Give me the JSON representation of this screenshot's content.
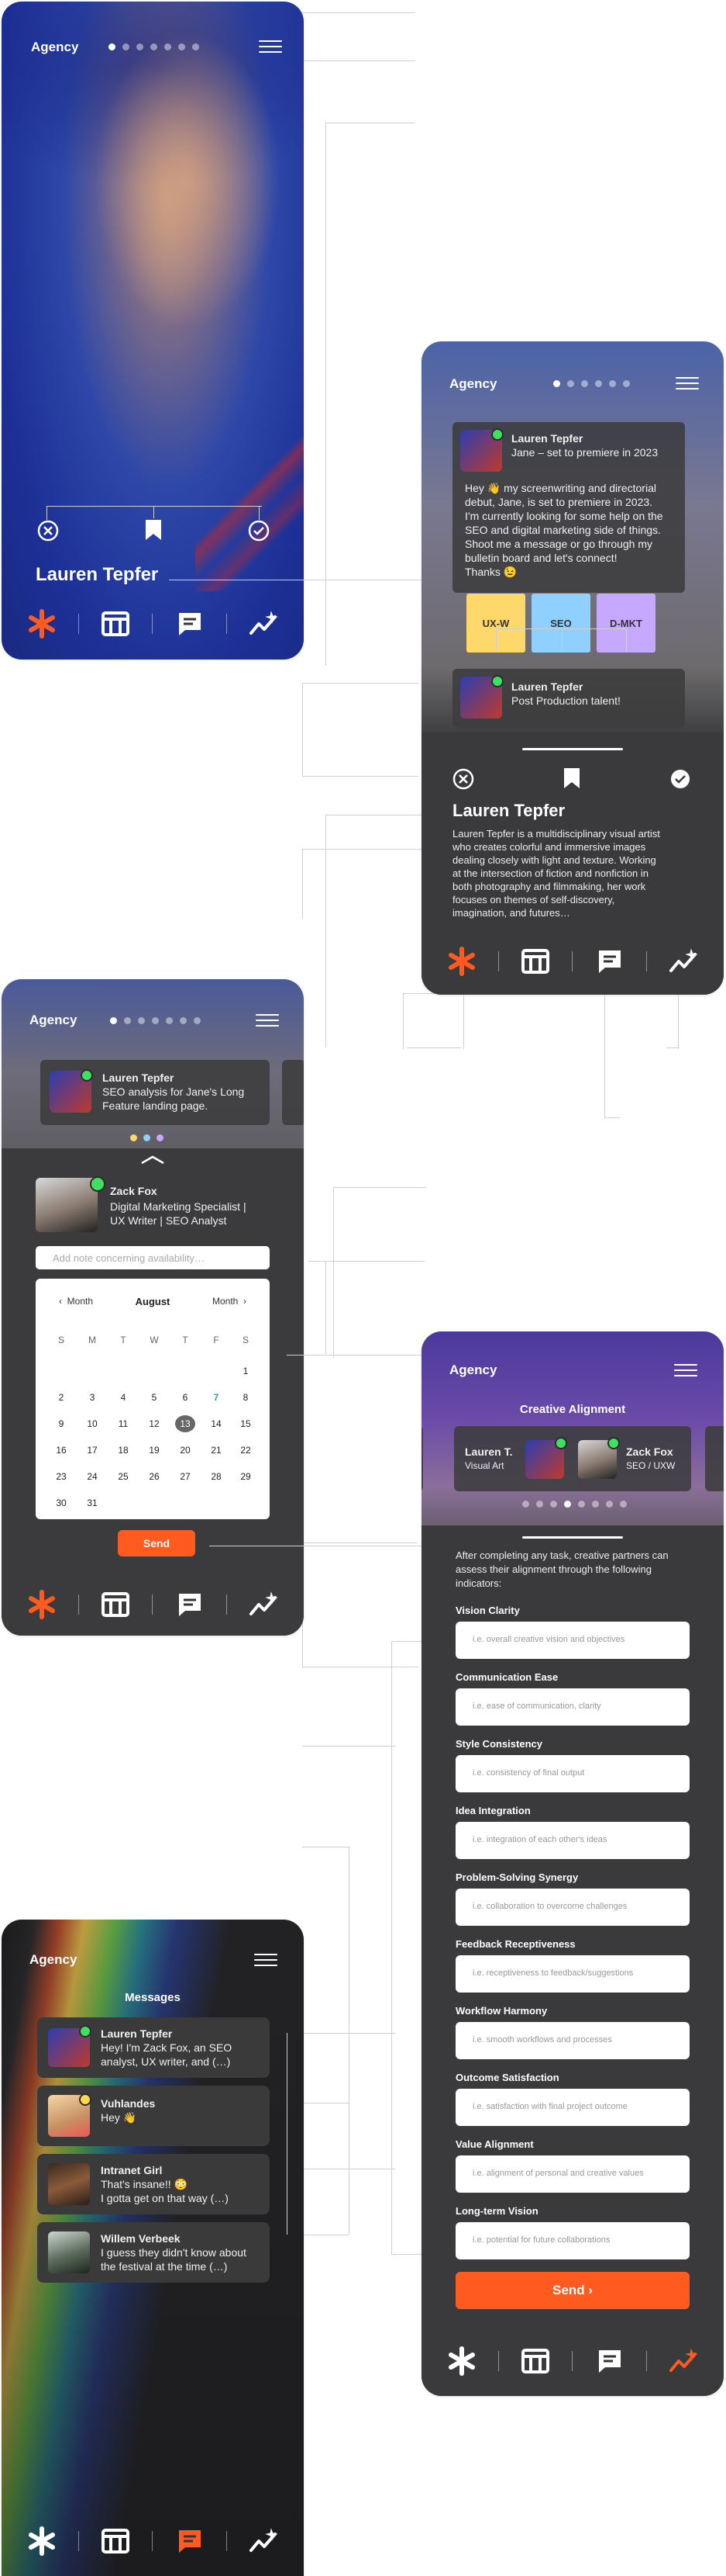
{
  "brand": "Agency",
  "screen1": {
    "name": "Lauren Tepfer"
  },
  "screen2": {
    "post": {
      "author": "Lauren Tepfer",
      "headline": "Jane – set to premiere in 2023",
      "body_lines": [
        "Hey 👋 my screenwriting and directorial",
        "debut, Jane, is set to premiere in 2023.",
        "I'm currently looking for some help on the",
        "SEO and digital marketing side of things.",
        "Shoot me a message or go through my",
        "bulletin board and let's connect!",
        "Thanks 😉"
      ]
    },
    "notes": [
      "UX-W",
      "SEO",
      "D-MKT"
    ],
    "post2": {
      "author": "Lauren Tepfer",
      "headline": "Post Production talent!"
    },
    "profile_name": "Lauren Tepfer",
    "bio_lines": [
      "Lauren Tepfer is a multidisciplinary visual artist",
      "who creates colorful and immersive images",
      "dealing closely with light and texture. Working",
      "at the intersection of fiction and nonfiction in",
      "both photography and filmmaking, her work",
      "focuses on themes of self-discovery,",
      "imagination, and futures…"
    ]
  },
  "screen3": {
    "post": {
      "author": "Lauren Tepfer",
      "line1": "SEO analysis for Jane's Long",
      "line2": "Feature landing page."
    },
    "person": {
      "name": "Zack Fox",
      "line1": "Digital Marketing Specialist |",
      "line2": "UX Writer | SEO Analyst"
    },
    "note_placeholder": "Add note concerning availability…",
    "calendar": {
      "prev": "Month",
      "month": "August",
      "next": "Month",
      "weekdays": [
        "S",
        "M",
        "T",
        "W",
        "T",
        "F",
        "S"
      ],
      "days": [
        "",
        "",
        "",
        "",
        "",
        "",
        "1",
        "2",
        "3",
        "4",
        "5",
        "6",
        "7",
        "8",
        "9",
        "10",
        "11",
        "12",
        "13",
        "14",
        "15",
        "16",
        "17",
        "18",
        "19",
        "20",
        "21",
        "22",
        "23",
        "24",
        "25",
        "26",
        "27",
        "28",
        "29",
        "30",
        "31"
      ],
      "selected": "13",
      "highlight": "7"
    },
    "send": "Send"
  },
  "screen4": {
    "title": "Creative Alignment",
    "left": {
      "name": "Lauren T.",
      "role": "Visual Art"
    },
    "right": {
      "name": "Zack Fox",
      "role": "SEO / UXW"
    },
    "intro_lines": [
      "After completing any task, creative partners can",
      "assess their alignment through the following",
      "indicators:"
    ],
    "indicators": [
      {
        "label": "Vision Clarity",
        "placeholder": "i.e. overall creative vision and objectives"
      },
      {
        "label": "Communication Ease",
        "placeholder": "i.e. ease of communication, clarity"
      },
      {
        "label": "Style Consistency",
        "placeholder": "i.e. consistency of final output"
      },
      {
        "label": "Idea Integration",
        "placeholder": "i.e. integration of each other's ideas"
      },
      {
        "label": "Problem-Solving Synergy",
        "placeholder": "i.e. collaboration to overcome challenges"
      },
      {
        "label": "Feedback Receptiveness",
        "placeholder": "i.e. receptiveness to feedback/suggestions"
      },
      {
        "label": "Workflow Harmony",
        "placeholder": "i.e. smooth workflows and processes"
      },
      {
        "label": "Outcome Satisfaction",
        "placeholder": "i.e. satisfaction with final project outcome"
      },
      {
        "label": "Value Alignment",
        "placeholder": "i.e. alignment of personal and creative values"
      },
      {
        "label": "Long-term Vision",
        "placeholder": "i.e. potential for future collaborations"
      }
    ],
    "send": "Send ›"
  },
  "screen5": {
    "title": "Messages",
    "messages": [
      {
        "name": "Lauren Tepfer",
        "line1": "Hey! I'm Zack Fox, an SEO",
        "line2": "analyst, UX writer, and (…)"
      },
      {
        "name": "Vuhlandes",
        "line1": "Hey 👋",
        "line2": ""
      },
      {
        "name": "Intranet Girl",
        "line1": "That's insane!! 😳",
        "line2": "I gotta get on that way (…)"
      },
      {
        "name": "Willem Verbeek",
        "line1": "I guess they didn't know about",
        "line2": "the festival at the time (…)"
      }
    ]
  },
  "colors": {
    "accent": "#ff5a1f",
    "note_yellow": "#ffd86b",
    "note_blue": "#8fd0ff",
    "note_purple": "#c6a8ff",
    "online": "#3ee060"
  }
}
